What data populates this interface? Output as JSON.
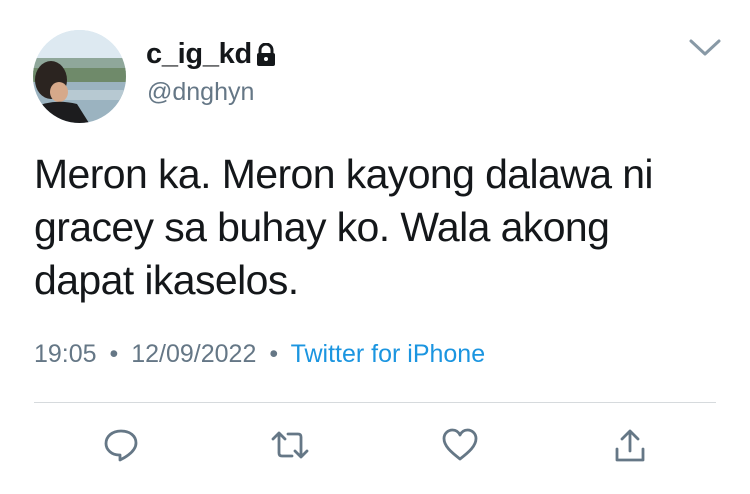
{
  "tweet": {
    "display_name": "c_ig_kd",
    "handle": "@dnghyn",
    "text_lines": [
      "Meron ka. Meron kayong dalawa ni",
      "gracey sa buhay ko. Wala akong",
      "dapat ikaselos."
    ],
    "time": "19:05",
    "separator": "•",
    "date": "12/09/2022",
    "source": "Twitter for iPhone"
  },
  "icons": {
    "protected": "lock-icon",
    "menu": "chevron-down-icon",
    "actions": [
      "reply-icon",
      "retweet-icon",
      "like-icon",
      "share-icon"
    ]
  },
  "colors": {
    "text": "#14171a",
    "secondary": "#657786",
    "link": "#1b95e0",
    "divider": "#d6dadd"
  }
}
